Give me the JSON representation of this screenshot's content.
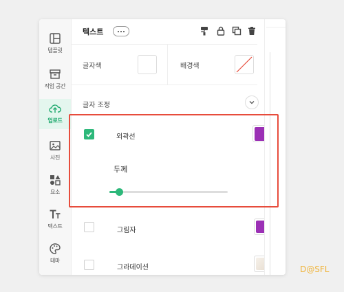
{
  "sidebar": {
    "items": [
      {
        "label": "템플릿",
        "icon": "template-icon",
        "active": false
      },
      {
        "label": "작업 공간",
        "icon": "archive-icon",
        "active": false
      },
      {
        "label": "업로드",
        "icon": "upload-cloud-icon",
        "active": true
      },
      {
        "label": "사진",
        "icon": "photo-icon",
        "active": false
      },
      {
        "label": "요소",
        "icon": "shapes-icon",
        "active": false
      },
      {
        "label": "텍스트",
        "icon": "text-tt-icon",
        "active": false
      },
      {
        "label": "테마",
        "icon": "palette-icon",
        "active": false
      }
    ]
  },
  "panel": {
    "title": "텍스트",
    "toolbar_icons": [
      "paint-roller-icon",
      "lock-icon",
      "duplicate-icon",
      "trash-icon"
    ],
    "text_color_label": "글자색",
    "bg_color_label": "배경색",
    "adjust_label": "글자 조정",
    "outline": {
      "label": "외곽선",
      "checked": true,
      "color": "#9b30b5"
    },
    "thickness": {
      "label": "두께",
      "value": "4",
      "fraction": 0.08
    },
    "shadow": {
      "label": "그림자",
      "checked": false,
      "color": "#9b30b5"
    },
    "gradient": {
      "label": "그라데이션",
      "checked": false,
      "color": "#eee6dc"
    }
  },
  "colors": {
    "accent": "#2db87a",
    "highlight": "#e74c3c",
    "purple": "#9b30b5"
  },
  "watermark": "D@SFL"
}
